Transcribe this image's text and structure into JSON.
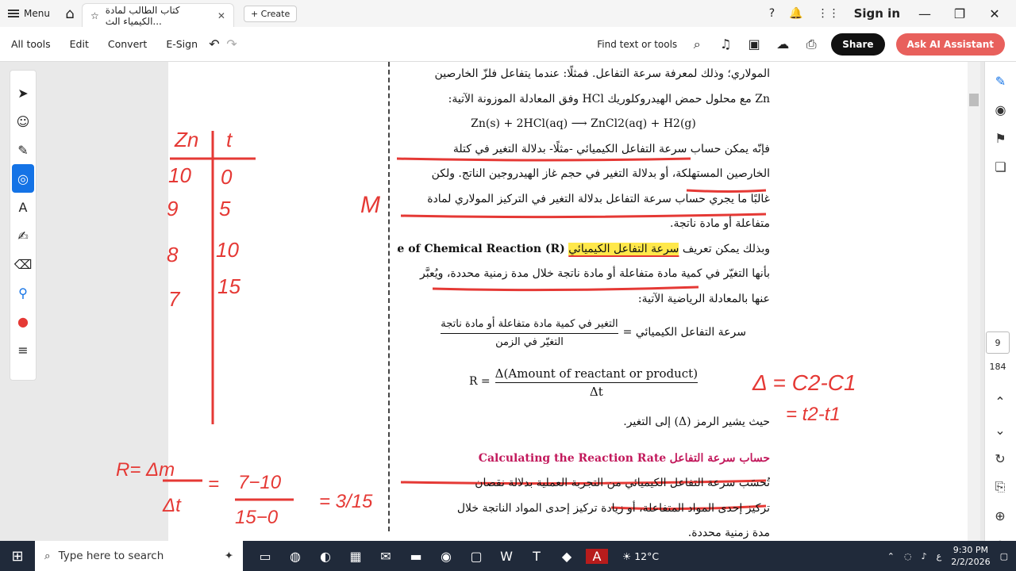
{
  "window": {
    "menu_label": "Menu",
    "tab_title": "كتاب الطالب لمادة الكيمياء الث...",
    "create_label": "Create",
    "sign_in": "Sign in"
  },
  "toolbar": {
    "all_tools": "All tools",
    "edit": "Edit",
    "convert": "Convert",
    "esign": "E-Sign",
    "find": "Find text or tools",
    "share": "Share",
    "ai": "Ask AI Assistant"
  },
  "doc": {
    "l1": "المولاري؛ وذلك لمعرفة سرعة التفاعل. فمثلًا: عندما يتفاعل فلزّ الخارصين",
    "l2": "Zn مع محلول حمض الهيدروكلوريك HCl وفق المعادلة الموزونة الآتية:",
    "eq1": "Zn(s) + 2HCl(aq) ⟶ ZnCl2(aq) + H2(g)",
    "l3": "فإنّه يمكن حساب سرعة التفاعل الكيميائي -مثلًا- بدلالة التغير في كتلة",
    "l4": "الخارصين المستهلكة، أو بدلالة التغير في حجم غاز الهيدروجين الناتج. ولكن",
    "l5": "غالبًا ما يجري حساب سرعة التفاعل بدلالة التغير في التركيز المولاري لمادة",
    "l6": "متفاعلة أو مادة ناتجة.",
    "l7a": "وبذلك يمكن تعريف",
    "l7b": "سرعة التفاعل الكيميائي",
    "l7c": "(Rate of Chemical Reaction (R:",
    "l8": "بأنها التغيّر في كمية مادة متفاعلة أو مادة ناتجة خلال مدة زمنية محددة، ويُعبَّر",
    "l9": "عنها بالمعادلة الرياضية الآتية:",
    "frac_left": "سرعة التفاعل الكيميائي =",
    "frac_num": "التغير في كمية مادة متفاعلة أو مادة ناتجة",
    "frac_den": "التغيّر في الزمن",
    "eq2_left": "R =",
    "eq2_num": "Δ(Amount of reactant or product)",
    "eq2_den": "Δt",
    "l10": "حيث يشير الرمز (Δ) إلى التغير.",
    "heading_ar": "حساب  سرعة التفاعل",
    "heading_en": "Calculating the Reaction Rate",
    "l11": "تُحسَب سرعة التفاعل الكيميائي من التجربة العملية بدلالة نقصان",
    "l12": "تركيز إحدى المواد المتفاعلة، أو زيادة تركيز إحدى المواد الناتجة خلال",
    "l13": "مدة زمنية محددة."
  },
  "annotations": {
    "col1": "Zn",
    "col2": "t",
    "r1a": "10",
    "r1b": "0",
    "r2a": "9",
    "r2b": "5",
    "r3a": "8",
    "r3b": "10",
    "r4a": "7",
    "r4b": "15",
    "m": "M",
    "formula": "R= Δm / Δt = 7-10 / 15-0 = 3/15",
    "delta": "Δ = C2-C1",
    "delta2": "= t2-t1"
  },
  "pager": {
    "current": "9",
    "total": "184"
  },
  "taskbar": {
    "search": "Type here to search",
    "weather": "12°C",
    "time": "9:30 PM",
    "date": "2/2/2026"
  }
}
